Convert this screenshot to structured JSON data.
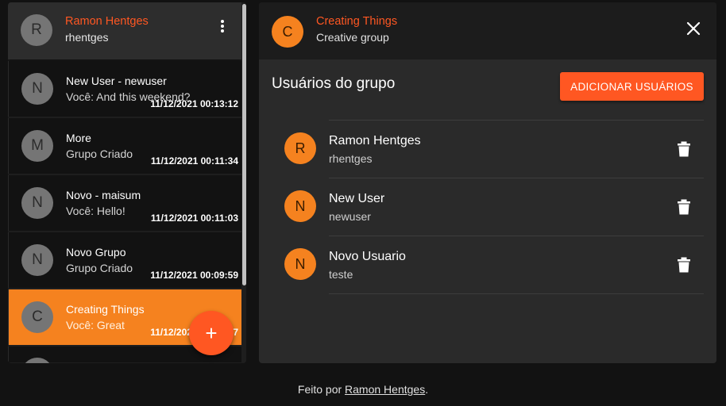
{
  "user": {
    "initial": "R",
    "name": "Ramon Hentges",
    "username": "rhentges"
  },
  "chats": [
    {
      "initial": "N",
      "title": "New User - newuser",
      "last_message": "Você: And this weekend?",
      "time": "11/12/2021 00:13:12",
      "active": false
    },
    {
      "initial": "M",
      "title": "More",
      "last_message": "Grupo Criado",
      "time": "11/12/2021 00:11:34",
      "active": false
    },
    {
      "initial": "N",
      "title": "Novo - maisum",
      "last_message": "Você: Hello!",
      "time": "11/12/2021 00:11:03",
      "active": false
    },
    {
      "initial": "N",
      "title": "Novo Grupo",
      "last_message": "Grupo Criado",
      "time": "11/12/2021 00:09:59",
      "active": false
    },
    {
      "initial": "C",
      "title": "Creating Things",
      "last_message": "Você: Great",
      "time": "11/12/2021 00:09:57",
      "active": true
    }
  ],
  "fab": {
    "symbol": "+"
  },
  "group": {
    "initial": "C",
    "name": "Creating Things",
    "description": "Creative group"
  },
  "members_section": {
    "title": "Usuários do grupo",
    "add_button_label": "ADICIONAR USUÁRIOS",
    "members": [
      {
        "initial": "R",
        "name": "Ramon Hentges",
        "username": "rhentges"
      },
      {
        "initial": "N",
        "name": "New User",
        "username": "newuser"
      },
      {
        "initial": "N",
        "name": "Novo Usuario",
        "username": "teste"
      }
    ]
  },
  "footer": {
    "prefix": "Feito por ",
    "author": "Ramon Hentges",
    "suffix": "."
  },
  "colors": {
    "accent": "#ff5722",
    "active": "#f5821f",
    "background": "#121212"
  },
  "icons": {
    "menu": "kebab-menu-icon",
    "close": "close-icon",
    "delete": "trash-icon",
    "add": "plus-icon"
  }
}
